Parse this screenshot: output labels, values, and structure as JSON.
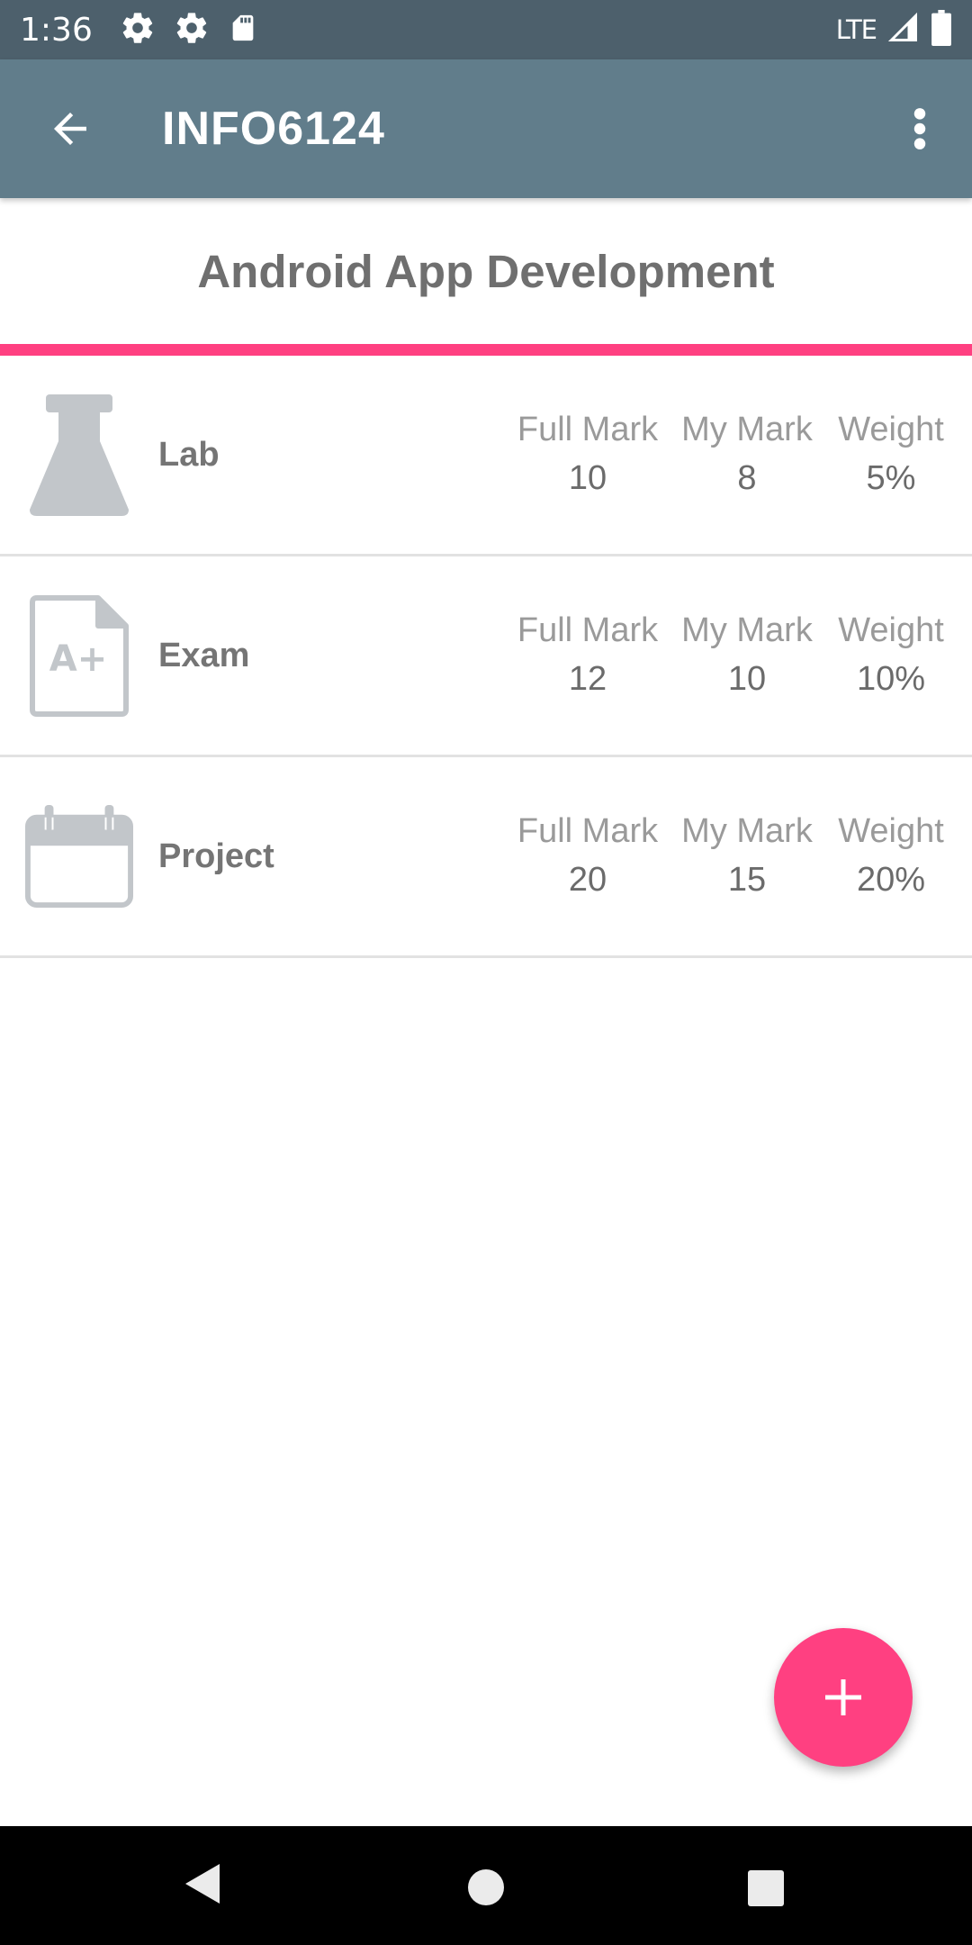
{
  "status_bar": {
    "time": "1:36",
    "network": "LTE",
    "icons": [
      "settings-icon",
      "settings-icon",
      "sd-card-icon",
      "signal-icon",
      "battery-icon"
    ]
  },
  "app_bar": {
    "title": "INFO6124",
    "back_icon": "arrow-back-icon",
    "menu_icon": "more-vert-icon"
  },
  "course": {
    "title": "Android App Development"
  },
  "columns": {
    "full_mark": "Full Mark",
    "my_mark": "My Mark",
    "weight": "Weight"
  },
  "assessments": [
    {
      "label": "Lab",
      "icon": "flask-icon",
      "full_mark": "10",
      "my_mark": "8",
      "weight": "5%"
    },
    {
      "label": "Exam",
      "icon": "exam-grade-icon",
      "full_mark": "12",
      "my_mark": "10",
      "weight": "10%"
    },
    {
      "label": "Project",
      "icon": "calendar-icon",
      "full_mark": "20",
      "my_mark": "15",
      "weight": "20%"
    }
  ],
  "fab": {
    "icon": "plus-icon"
  },
  "colors": {
    "status_bar": "#4d606c",
    "app_bar": "#617d8b",
    "accent": "#ff4081",
    "icon_gray": "#c2c6ca"
  }
}
